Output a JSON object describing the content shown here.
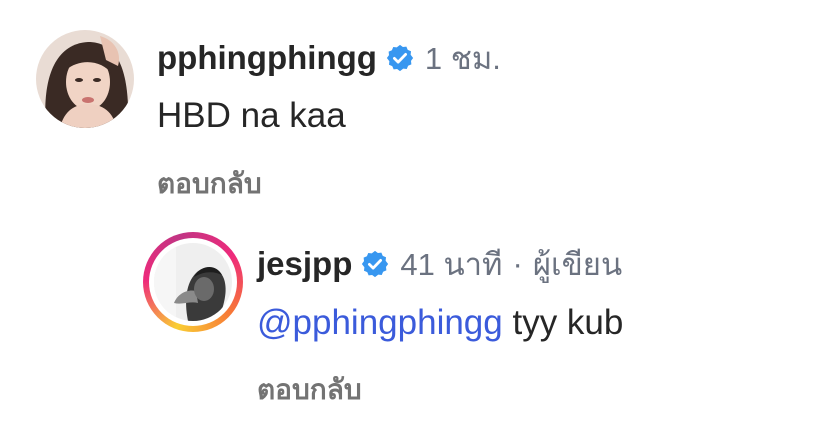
{
  "comments": [
    {
      "username": "pphingphingg",
      "verified": true,
      "time": "1 ชม.",
      "text": "HBD na kaa",
      "reply_label": "ตอบกลับ",
      "avatar_icon": "profile-photo-woman"
    }
  ],
  "reply": {
    "username": "jesjpp",
    "verified": true,
    "time": "41 นาที",
    "separator": "·",
    "author_badge": "ผู้เขียน",
    "mention": "@pphingphingg",
    "text": " tyy kub",
    "reply_label": "ตอบกลับ",
    "avatar_icon": "profile-photo-bw",
    "story_ring": true
  },
  "colors": {
    "verified": "#3897f0",
    "mention": "#3b5bdb",
    "muted": "#6b7280"
  }
}
